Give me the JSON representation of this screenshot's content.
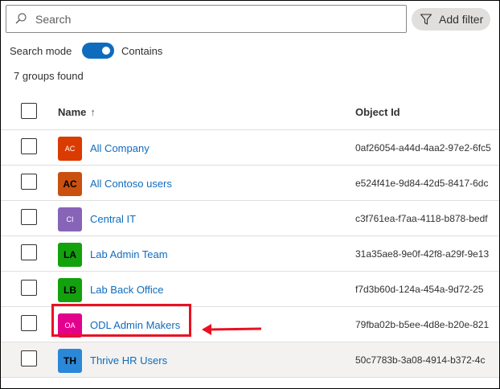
{
  "search": {
    "placeholder": "Search"
  },
  "filter": {
    "label": "Add filter"
  },
  "search_mode": {
    "label": "Search mode",
    "toggle_on": true,
    "value_label": "Contains"
  },
  "result_count": "7 groups found",
  "table": {
    "columns": {
      "name": "Name",
      "sort_glyph": "↑",
      "object_id": "Object Id"
    },
    "rows": [
      {
        "initials": "AC",
        "name": "All Company",
        "object_id": "0af26054-a44d-4aa2-97e2-6fc5",
        "color": "#da3b01"
      },
      {
        "initials": "AC",
        "name": "All Contoso users",
        "object_id": "e524f41e-9d84-42d5-8417-6dc",
        "color": "#ca5010"
      },
      {
        "initials": "CI",
        "name": "Central IT",
        "object_id": "c3f761ea-f7aa-4118-b878-bedf",
        "color": "#8764b8"
      },
      {
        "initials": "LA",
        "name": "Lab Admin Team",
        "object_id": "31a35ae8-9e0f-42f8-a29f-9e13",
        "color": "#13a10e"
      },
      {
        "initials": "LB",
        "name": "Lab Back Office",
        "object_id": "f7d3b60d-124a-454a-9d72-25",
        "color": "#13a10e"
      },
      {
        "initials": "OA",
        "name": "ODL Admin Makers",
        "object_id": "79fba02b-b5ee-4d8e-b20e-821",
        "color": "#e3008c"
      },
      {
        "initials": "TH",
        "name": "Thrive HR Users",
        "object_id": "50c7783b-3a08-4914-b372-4c",
        "color": "#2b88d8"
      }
    ]
  },
  "colors": {
    "accent": "#0f6cbd",
    "callout": "#e81123"
  }
}
